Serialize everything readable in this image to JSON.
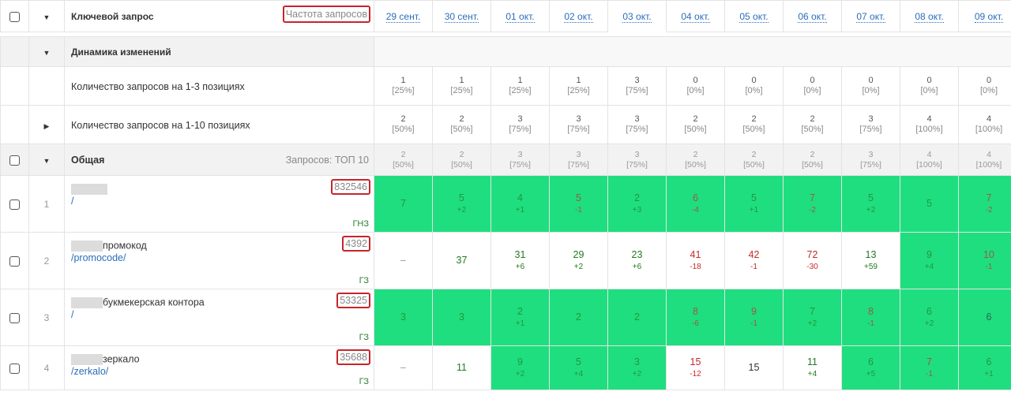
{
  "header": {
    "keyword_label": "Ключевой запрос",
    "freq_label": "Частота запросов",
    "dates": [
      "29 сент.",
      "30 сент.",
      "01 окт.",
      "02 окт.",
      "03 окт.",
      "04 окт.",
      "05 окт.",
      "06 окт.",
      "07 окт.",
      "08 окт.",
      "09 окт."
    ]
  },
  "dynamics": {
    "label": "Динамика изменений",
    "top3": {
      "label": "Количество запросов на 1-3 позициях",
      "values": [
        [
          "1",
          "[25%]"
        ],
        [
          "1",
          "[25%]"
        ],
        [
          "1",
          "[25%]"
        ],
        [
          "1",
          "[25%]"
        ],
        [
          "3",
          "[75%]"
        ],
        [
          "0",
          "[0%]"
        ],
        [
          "0",
          "[0%]"
        ],
        [
          "0",
          "[0%]"
        ],
        [
          "0",
          "[0%]"
        ],
        [
          "0",
          "[0%]"
        ],
        [
          "0",
          "[0%]"
        ]
      ]
    },
    "top10": {
      "label": "Количество запросов на 1-10 позициях",
      "values": [
        [
          "2",
          "[50%]"
        ],
        [
          "2",
          "[50%]"
        ],
        [
          "3",
          "[75%]"
        ],
        [
          "3",
          "[75%]"
        ],
        [
          "3",
          "[75%]"
        ],
        [
          "2",
          "[50%]"
        ],
        [
          "2",
          "[50%]"
        ],
        [
          "2",
          "[50%]"
        ],
        [
          "3",
          "[75%]"
        ],
        [
          "4",
          "[100%]"
        ],
        [
          "4",
          "[100%]"
        ]
      ]
    }
  },
  "group": {
    "label": "Общая",
    "count_label": "Запросов: ТОП 10",
    "values": [
      [
        "2",
        "[50%]"
      ],
      [
        "2",
        "[50%]"
      ],
      [
        "3",
        "[75%]"
      ],
      [
        "3",
        "[75%]"
      ],
      [
        "3",
        "[75%]"
      ],
      [
        "2",
        "[50%]"
      ],
      [
        "2",
        "[50%]"
      ],
      [
        "2",
        "[50%]"
      ],
      [
        "3",
        "[75%]"
      ],
      [
        "4",
        "[100%]"
      ],
      [
        "4",
        "[100%]"
      ]
    ]
  },
  "keywords": [
    {
      "num": "1",
      "text": "",
      "url": "/",
      "freq": "832546",
      "type": "ГНЗ",
      "cells": [
        {
          "v": "7",
          "d": "",
          "green": true,
          "vc": "cg",
          "dc": "cg"
        },
        {
          "v": "5",
          "d": "+2",
          "green": true,
          "vc": "cg",
          "dc": "cg"
        },
        {
          "v": "4",
          "d": "+1",
          "green": true,
          "vc": "cg",
          "dc": "cg"
        },
        {
          "v": "5",
          "d": "-1",
          "green": true,
          "vc": "cr",
          "dc": "cr"
        },
        {
          "v": "2",
          "d": "+3",
          "green": true,
          "vc": "cg",
          "dc": "cg"
        },
        {
          "v": "6",
          "d": "-4",
          "green": true,
          "vc": "cr",
          "dc": "cr"
        },
        {
          "v": "5",
          "d": "+1",
          "green": true,
          "vc": "cg",
          "dc": "cg"
        },
        {
          "v": "7",
          "d": "-2",
          "green": true,
          "vc": "cr",
          "dc": "cr"
        },
        {
          "v": "5",
          "d": "+2",
          "green": true,
          "vc": "cg",
          "dc": "cg"
        },
        {
          "v": "5",
          "d": "",
          "green": true,
          "vc": "cg",
          "dc": "cg"
        },
        {
          "v": "7",
          "d": "-2",
          "green": true,
          "vc": "cr",
          "dc": "cr"
        }
      ]
    },
    {
      "num": "2",
      "text": "промокод",
      "url": "/promocode/",
      "freq": "4392",
      "type": "ГЗ",
      "cells": [
        {
          "v": "–",
          "d": "",
          "green": false,
          "vc": "cd",
          "dc": "cd"
        },
        {
          "v": "37",
          "d": "",
          "green": false,
          "vc": "cg",
          "dc": "cg"
        },
        {
          "v": "31",
          "d": "+6",
          "green": false,
          "vc": "cg",
          "dc": "cg"
        },
        {
          "v": "29",
          "d": "+2",
          "green": false,
          "vc": "cg",
          "dc": "cg"
        },
        {
          "v": "23",
          "d": "+6",
          "green": false,
          "vc": "cg",
          "dc": "cg"
        },
        {
          "v": "41",
          "d": "-18",
          "green": false,
          "vc": "cr",
          "dc": "cr"
        },
        {
          "v": "42",
          "d": "-1",
          "green": false,
          "vc": "cr",
          "dc": "cr"
        },
        {
          "v": "72",
          "d": "-30",
          "green": false,
          "vc": "cr",
          "dc": "cr"
        },
        {
          "v": "13",
          "d": "+59",
          "green": false,
          "vc": "cg",
          "dc": "cg"
        },
        {
          "v": "9",
          "d": "+4",
          "green": true,
          "vc": "cg",
          "dc": "cg"
        },
        {
          "v": "10",
          "d": "-1",
          "green": true,
          "vc": "cr",
          "dc": "cr"
        }
      ]
    },
    {
      "num": "3",
      "text": "букмекерская контора",
      "url": "/",
      "freq": "53325",
      "type": "ГЗ",
      "cells": [
        {
          "v": "3",
          "d": "",
          "green": true,
          "vc": "cg",
          "dc": "cg"
        },
        {
          "v": "3",
          "d": "",
          "green": true,
          "vc": "cg",
          "dc": "cg"
        },
        {
          "v": "2",
          "d": "+1",
          "green": true,
          "vc": "cg",
          "dc": "cg"
        },
        {
          "v": "2",
          "d": "",
          "green": true,
          "vc": "cg",
          "dc": "cg"
        },
        {
          "v": "2",
          "d": "",
          "green": true,
          "vc": "cg",
          "dc": "cg"
        },
        {
          "v": "8",
          "d": "-6",
          "green": true,
          "vc": "cr",
          "dc": "cr"
        },
        {
          "v": "9",
          "d": "-1",
          "green": true,
          "vc": "cr",
          "dc": "cr"
        },
        {
          "v": "7",
          "d": "+2",
          "green": true,
          "vc": "cg",
          "dc": "cg"
        },
        {
          "v": "8",
          "d": "-1",
          "green": true,
          "vc": "cr",
          "dc": "cr"
        },
        {
          "v": "6",
          "d": "+2",
          "green": true,
          "vc": "cg",
          "dc": "cg"
        },
        {
          "v": "6",
          "d": "",
          "green": true,
          "vc": "cn",
          "dc": "cn"
        }
      ]
    },
    {
      "num": "4",
      "text": "зеркало",
      "url": "/zerkalo/",
      "freq": "35688",
      "type": "ГЗ",
      "cells": [
        {
          "v": "–",
          "d": "",
          "green": false,
          "vc": "cd",
          "dc": "cd"
        },
        {
          "v": "11",
          "d": "",
          "green": false,
          "vc": "cg",
          "dc": "cg"
        },
        {
          "v": "9",
          "d": "+2",
          "green": true,
          "vc": "cg",
          "dc": "cg"
        },
        {
          "v": "5",
          "d": "+4",
          "green": true,
          "vc": "cg",
          "dc": "cg"
        },
        {
          "v": "3",
          "d": "+2",
          "green": true,
          "vc": "cg",
          "dc": "cg"
        },
        {
          "v": "15",
          "d": "-12",
          "green": false,
          "vc": "cr",
          "dc": "cr"
        },
        {
          "v": "15",
          "d": "",
          "green": false,
          "vc": "cn",
          "dc": "cn"
        },
        {
          "v": "11",
          "d": "+4",
          "green": false,
          "vc": "cg",
          "dc": "cg"
        },
        {
          "v": "6",
          "d": "+5",
          "green": true,
          "vc": "cg",
          "dc": "cg"
        },
        {
          "v": "7",
          "d": "-1",
          "green": true,
          "vc": "cr",
          "dc": "cr"
        },
        {
          "v": "6",
          "d": "+1",
          "green": true,
          "vc": "cg",
          "dc": "cg"
        }
      ]
    }
  ]
}
